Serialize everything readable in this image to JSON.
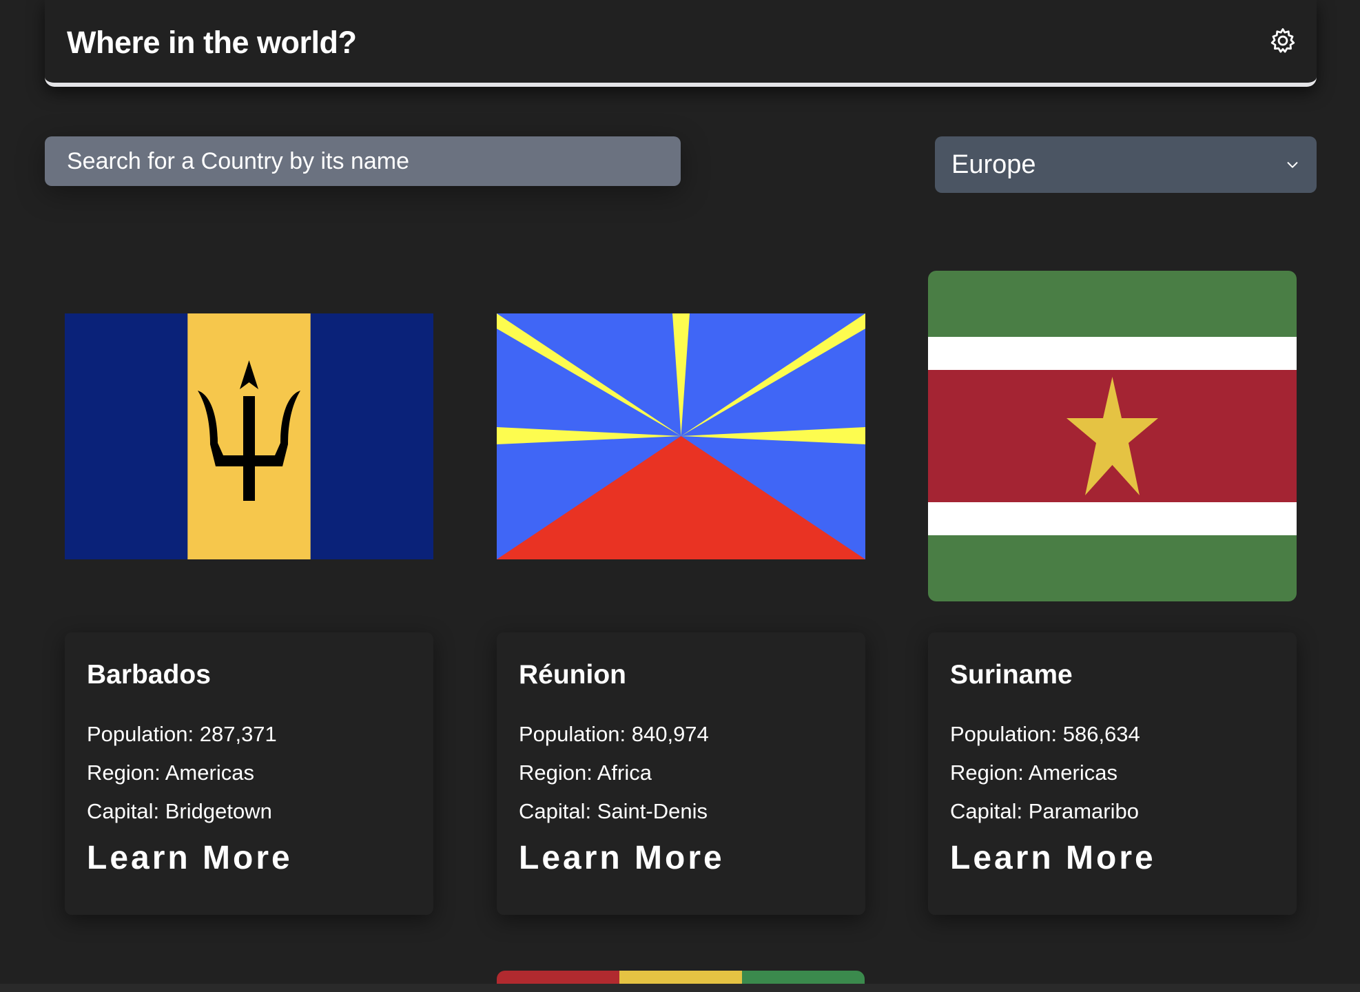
{
  "header": {
    "title": "Where in the world?",
    "theme_icon": "gear-icon"
  },
  "search": {
    "placeholder": "Search for a Country by its name",
    "value": ""
  },
  "region_filter": {
    "selected": "Europe"
  },
  "countries": [
    {
      "name": "Barbados",
      "population_label": "Population: 287,371",
      "region_label": "Region: Americas",
      "capital_label": "Capital: Bridgetown",
      "cta": "Learn More",
      "flag_colors": [
        "#0a2279",
        "#f6c74c",
        "#000000"
      ]
    },
    {
      "name": "Réunion",
      "population_label": "Population: 840,974",
      "region_label": "Region: Africa",
      "capital_label": "Capital: Saint-Denis",
      "cta": "Learn More",
      "flag_colors": [
        "#4066f6",
        "#fdfc4f",
        "#e93323"
      ]
    },
    {
      "name": "Suriname",
      "population_label": "Population: 586,634",
      "region_label": "Region: Americas",
      "capital_label": "Capital: Paramaribo",
      "cta": "Learn More",
      "flag_colors": [
        "#4a7e45",
        "#ffffff",
        "#a42433",
        "#e5c343"
      ]
    }
  ],
  "next_row_flag_colors": [
    "#b12a2f",
    "#e5c343",
    "#3b8a4d"
  ]
}
